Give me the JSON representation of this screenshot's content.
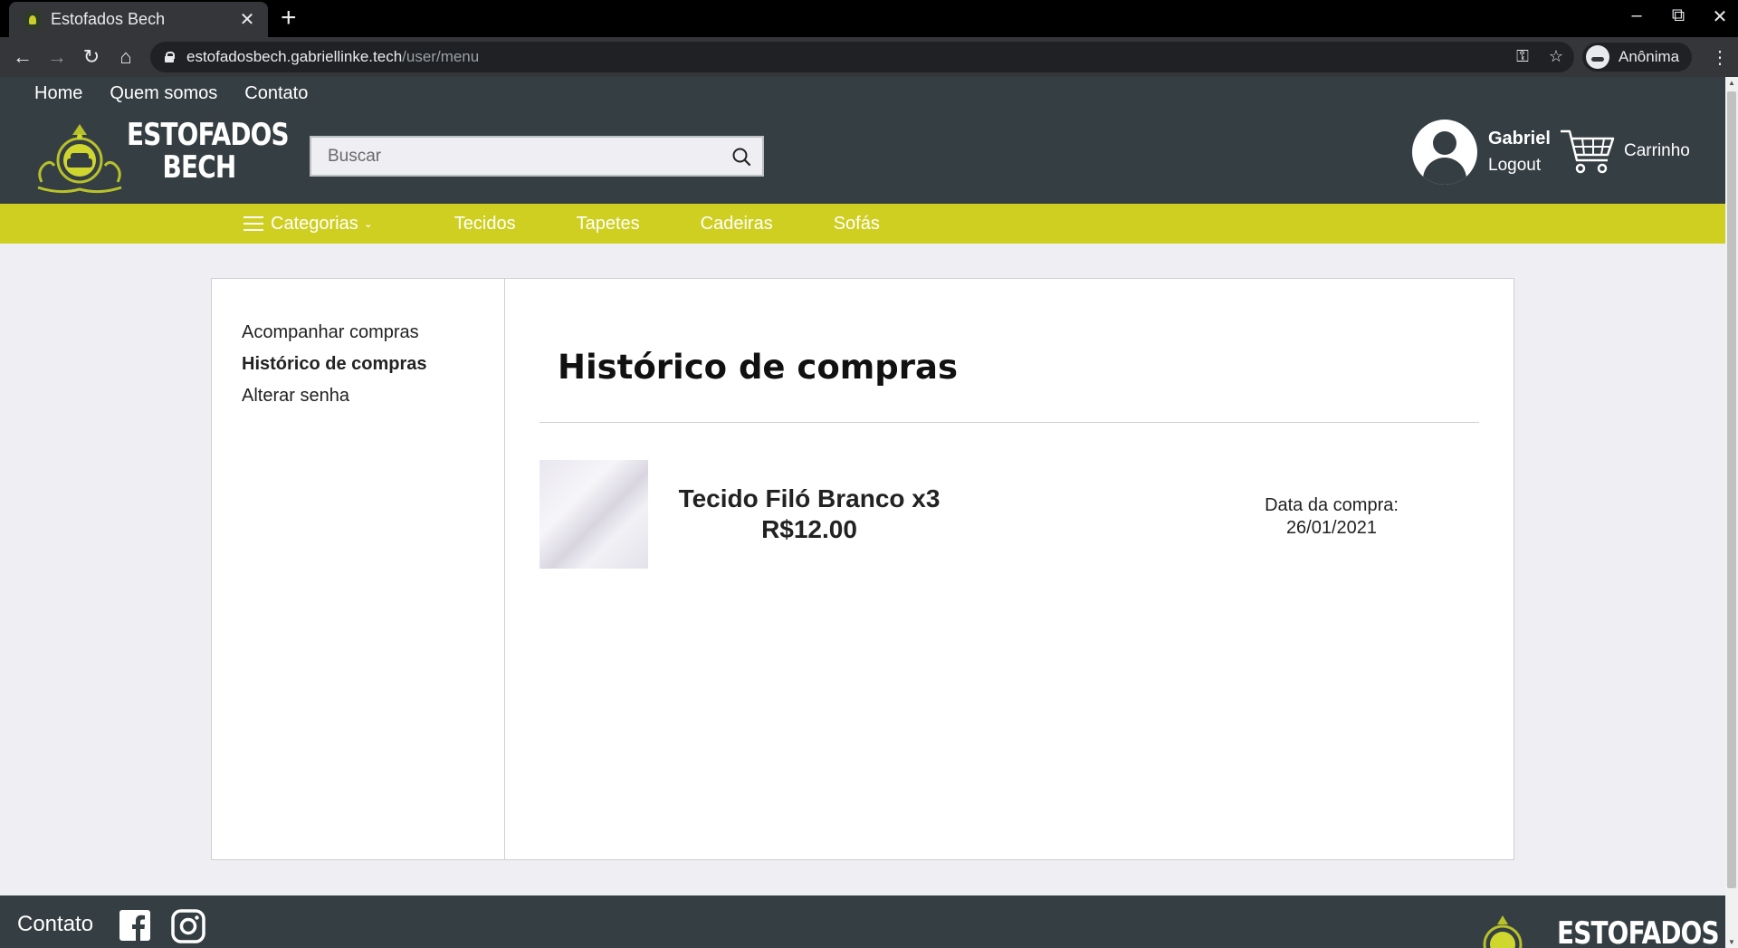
{
  "browser": {
    "tab_title": "Estofados Bech",
    "new_tab": "+",
    "tab_close": "✕",
    "url_host": "estofadosbech.gabriellinke.tech",
    "url_path": "/user/menu",
    "profile_label": "Anônima"
  },
  "header": {
    "topnav": [
      "Home",
      "Quem somos",
      "Contato"
    ],
    "logo_line1": "ESTOFADOS",
    "logo_line2": "BECH",
    "search_placeholder": "Buscar",
    "user_name": "Gabriel",
    "logout_label": "Logout",
    "cart_label": "Carrinho"
  },
  "categories": {
    "menu_label": "Categorias",
    "items": [
      "Tecidos",
      "Tapetes",
      "Cadeiras",
      "Sofás"
    ]
  },
  "sidebar": {
    "items": [
      "Acompanhar compras",
      "Histórico de compras",
      "Alterar senha"
    ],
    "active_index": 1
  },
  "main": {
    "title": "Histórico de compras",
    "orders": [
      {
        "product": "Tecido Filó Branco x3",
        "price": "R$12.00",
        "date_label": "Data da compra:",
        "date": "26/01/2021"
      }
    ]
  },
  "footer": {
    "label": "Contato",
    "logo_text": "ESTOFADOS"
  },
  "colors": {
    "header_bg": "#353e43",
    "accent_yellow": "#cfcf22",
    "page_bg": "#eeeef3"
  }
}
